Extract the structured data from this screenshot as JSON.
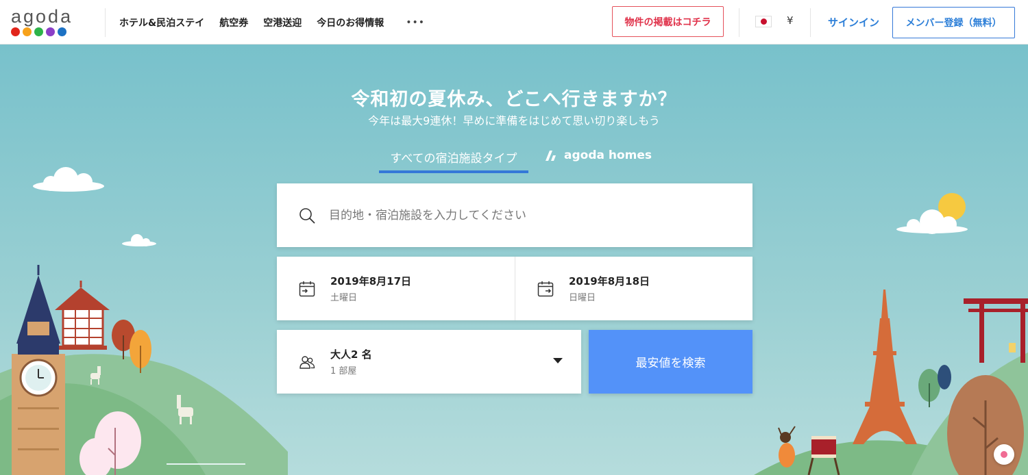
{
  "header": {
    "logo_text": "agoda",
    "logo_dot_colors": [
      "#e1251b",
      "#f7a21b",
      "#2db34a",
      "#8b3fc7",
      "#1d72c4"
    ],
    "nav": [
      "ホテル&民泊ステイ",
      "航空券",
      "空港送迎",
      "今日のお得情報"
    ],
    "more": "•••",
    "list_property": "物件の掲載はコチラ",
    "currency": "¥",
    "signin": "サインイン",
    "register": "メンバー登録（無料）"
  },
  "hero": {
    "headline": "令和初の夏休み、どこへ行きますか？",
    "subheadline": "今年は最大9連休！早めに準備をはじめて思い切り楽しもう",
    "tabs": {
      "all": "すべての宿泊施設タイプ",
      "homes": "agoda homes"
    }
  },
  "search": {
    "placeholder": "目的地・宿泊施設を入力してください",
    "checkin_date": "2019年8月17日",
    "checkin_day": "土曜日",
    "checkout_date": "2019年8月18日",
    "checkout_day": "日曜日",
    "guests": "大人2 名",
    "rooms": "1 部屋",
    "button": "最安値を検索"
  },
  "colors": {
    "brand_blue": "#5392f9",
    "link_blue": "#2d7fd8",
    "accent_red": "#e0324a",
    "sky": "#78c1cb"
  }
}
